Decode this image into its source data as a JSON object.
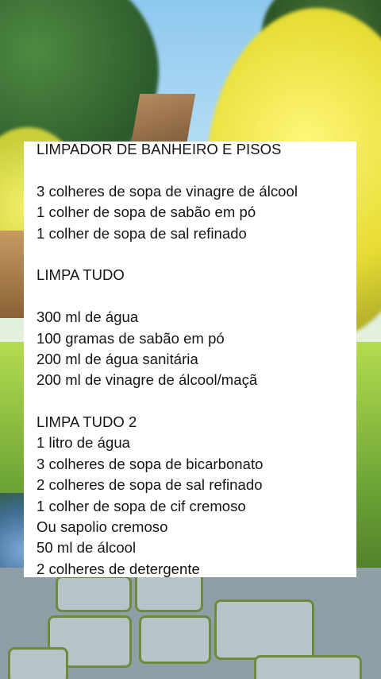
{
  "background": {
    "scene": "garden-illustration",
    "colors": {
      "sky": "#bfe2f5",
      "foliage_yellow": "#f3ef6a",
      "foliage_green": "#4f8a42",
      "stone": "#b6c3c7"
    }
  },
  "card": {
    "background": "#ffffff",
    "text_color": "#141414",
    "lines": [
      "LIMPADOR DE BANHEIRO E PISOS",
      "",
      "3 colheres de sopa de vinagre de álcool",
      "1 colher de sopa de sabão em pó",
      "1 colher de sopa de sal refinado",
      "",
      "LIMPA TUDO",
      "",
      "300 ml de água",
      "100 gramas de sabão em pó",
      "200 ml de água sanitária",
      "200 ml de vinagre de álcool/maçã",
      "",
      "LIMPA TUDO 2",
      "1 litro de água",
      "3 colheres de sopa de bicarbonato",
      "2 colheres de sopa de sal refinado",
      "1 colher de sopa de cif cremoso",
      "Ou sapolio cremoso",
      "50 ml de álcool",
      "2 colheres de detergente"
    ]
  }
}
